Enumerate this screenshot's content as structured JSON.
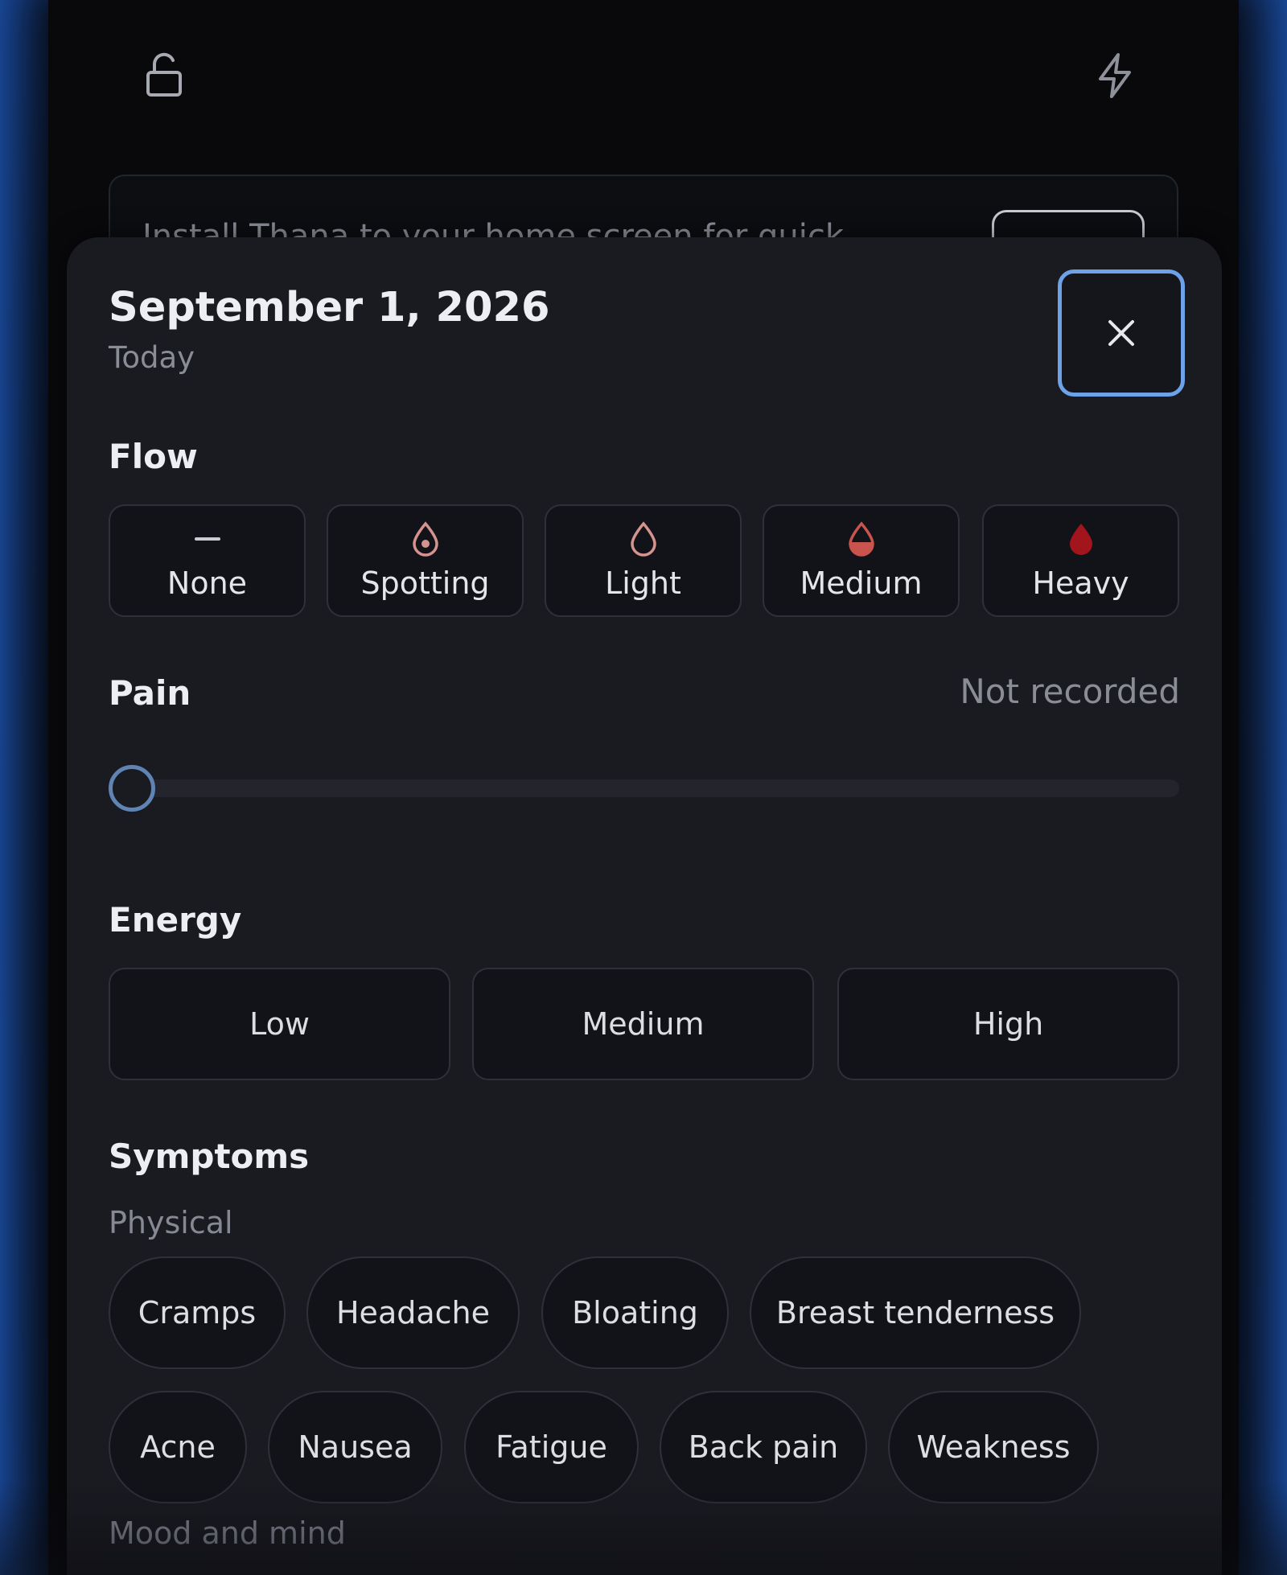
{
  "install_banner": {
    "text": "Install Thana to your home screen for quick"
  },
  "sheet": {
    "date": "September 1, 2026",
    "date_sub": "Today",
    "close_icon": "close-icon",
    "flow": {
      "label": "Flow",
      "options": [
        {
          "label": "None",
          "icon": "dash-icon",
          "color": "#c9ccd3"
        },
        {
          "label": "Spotting",
          "icon": "drop-dot-icon",
          "color": "#d4938f"
        },
        {
          "label": "Light",
          "icon": "drop-outline-icon",
          "color": "#d4938f"
        },
        {
          "label": "Medium",
          "icon": "drop-half-icon",
          "color": "#c9534d"
        },
        {
          "label": "Heavy",
          "icon": "drop-filled-icon",
          "color": "#a3151c"
        }
      ]
    },
    "pain": {
      "label": "Pain",
      "status": "Not recorded",
      "value": 0
    },
    "energy": {
      "label": "Energy",
      "options": [
        "Low",
        "Medium",
        "High"
      ]
    },
    "symptoms": {
      "label": "Symptoms",
      "physical_label": "Physical",
      "physical": [
        "Cramps",
        "Headache",
        "Bloating",
        "Breast tenderness",
        "Acne",
        "Nausea",
        "Fatigue",
        "Back pain",
        "Weakness"
      ],
      "mood_label": "Mood and mind"
    }
  }
}
